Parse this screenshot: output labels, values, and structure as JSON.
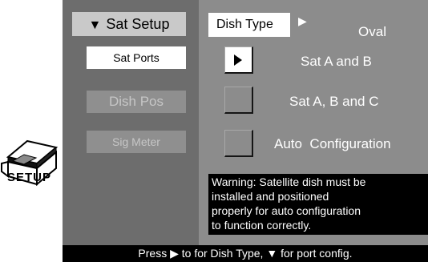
{
  "sidebar": {
    "title": "Sat Setup",
    "items": [
      {
        "label": "Sat Ports",
        "state": "selected"
      },
      {
        "label": "Dish Pos",
        "state": "disabled"
      },
      {
        "label": "Sig Meter",
        "state": "disabled"
      }
    ]
  },
  "tab": {
    "label": "Dish Type",
    "value": "Oval"
  },
  "options": [
    {
      "label": "Sat A and B",
      "selected": true
    },
    {
      "label": "Sat A, B and C",
      "selected": false
    },
    {
      "label": "Auto  Configuration",
      "selected": false
    }
  ],
  "warning": {
    "lines": [
      "Warning: Satellite dish must be",
      "installed and positioned",
      "properly for auto configuration",
      "to function correctly."
    ]
  },
  "footer": {
    "text": "Press ▶ to for Dish Type, ▼ for port config."
  },
  "icon": {
    "name": "setup-icon",
    "label": "SETUP"
  },
  "colors": {
    "sidebar_bg": "#6d6d6d",
    "content_bg": "#8c8c8c",
    "selected_bg": "#ffffff",
    "disabled_bg": "#8f8f8f"
  }
}
